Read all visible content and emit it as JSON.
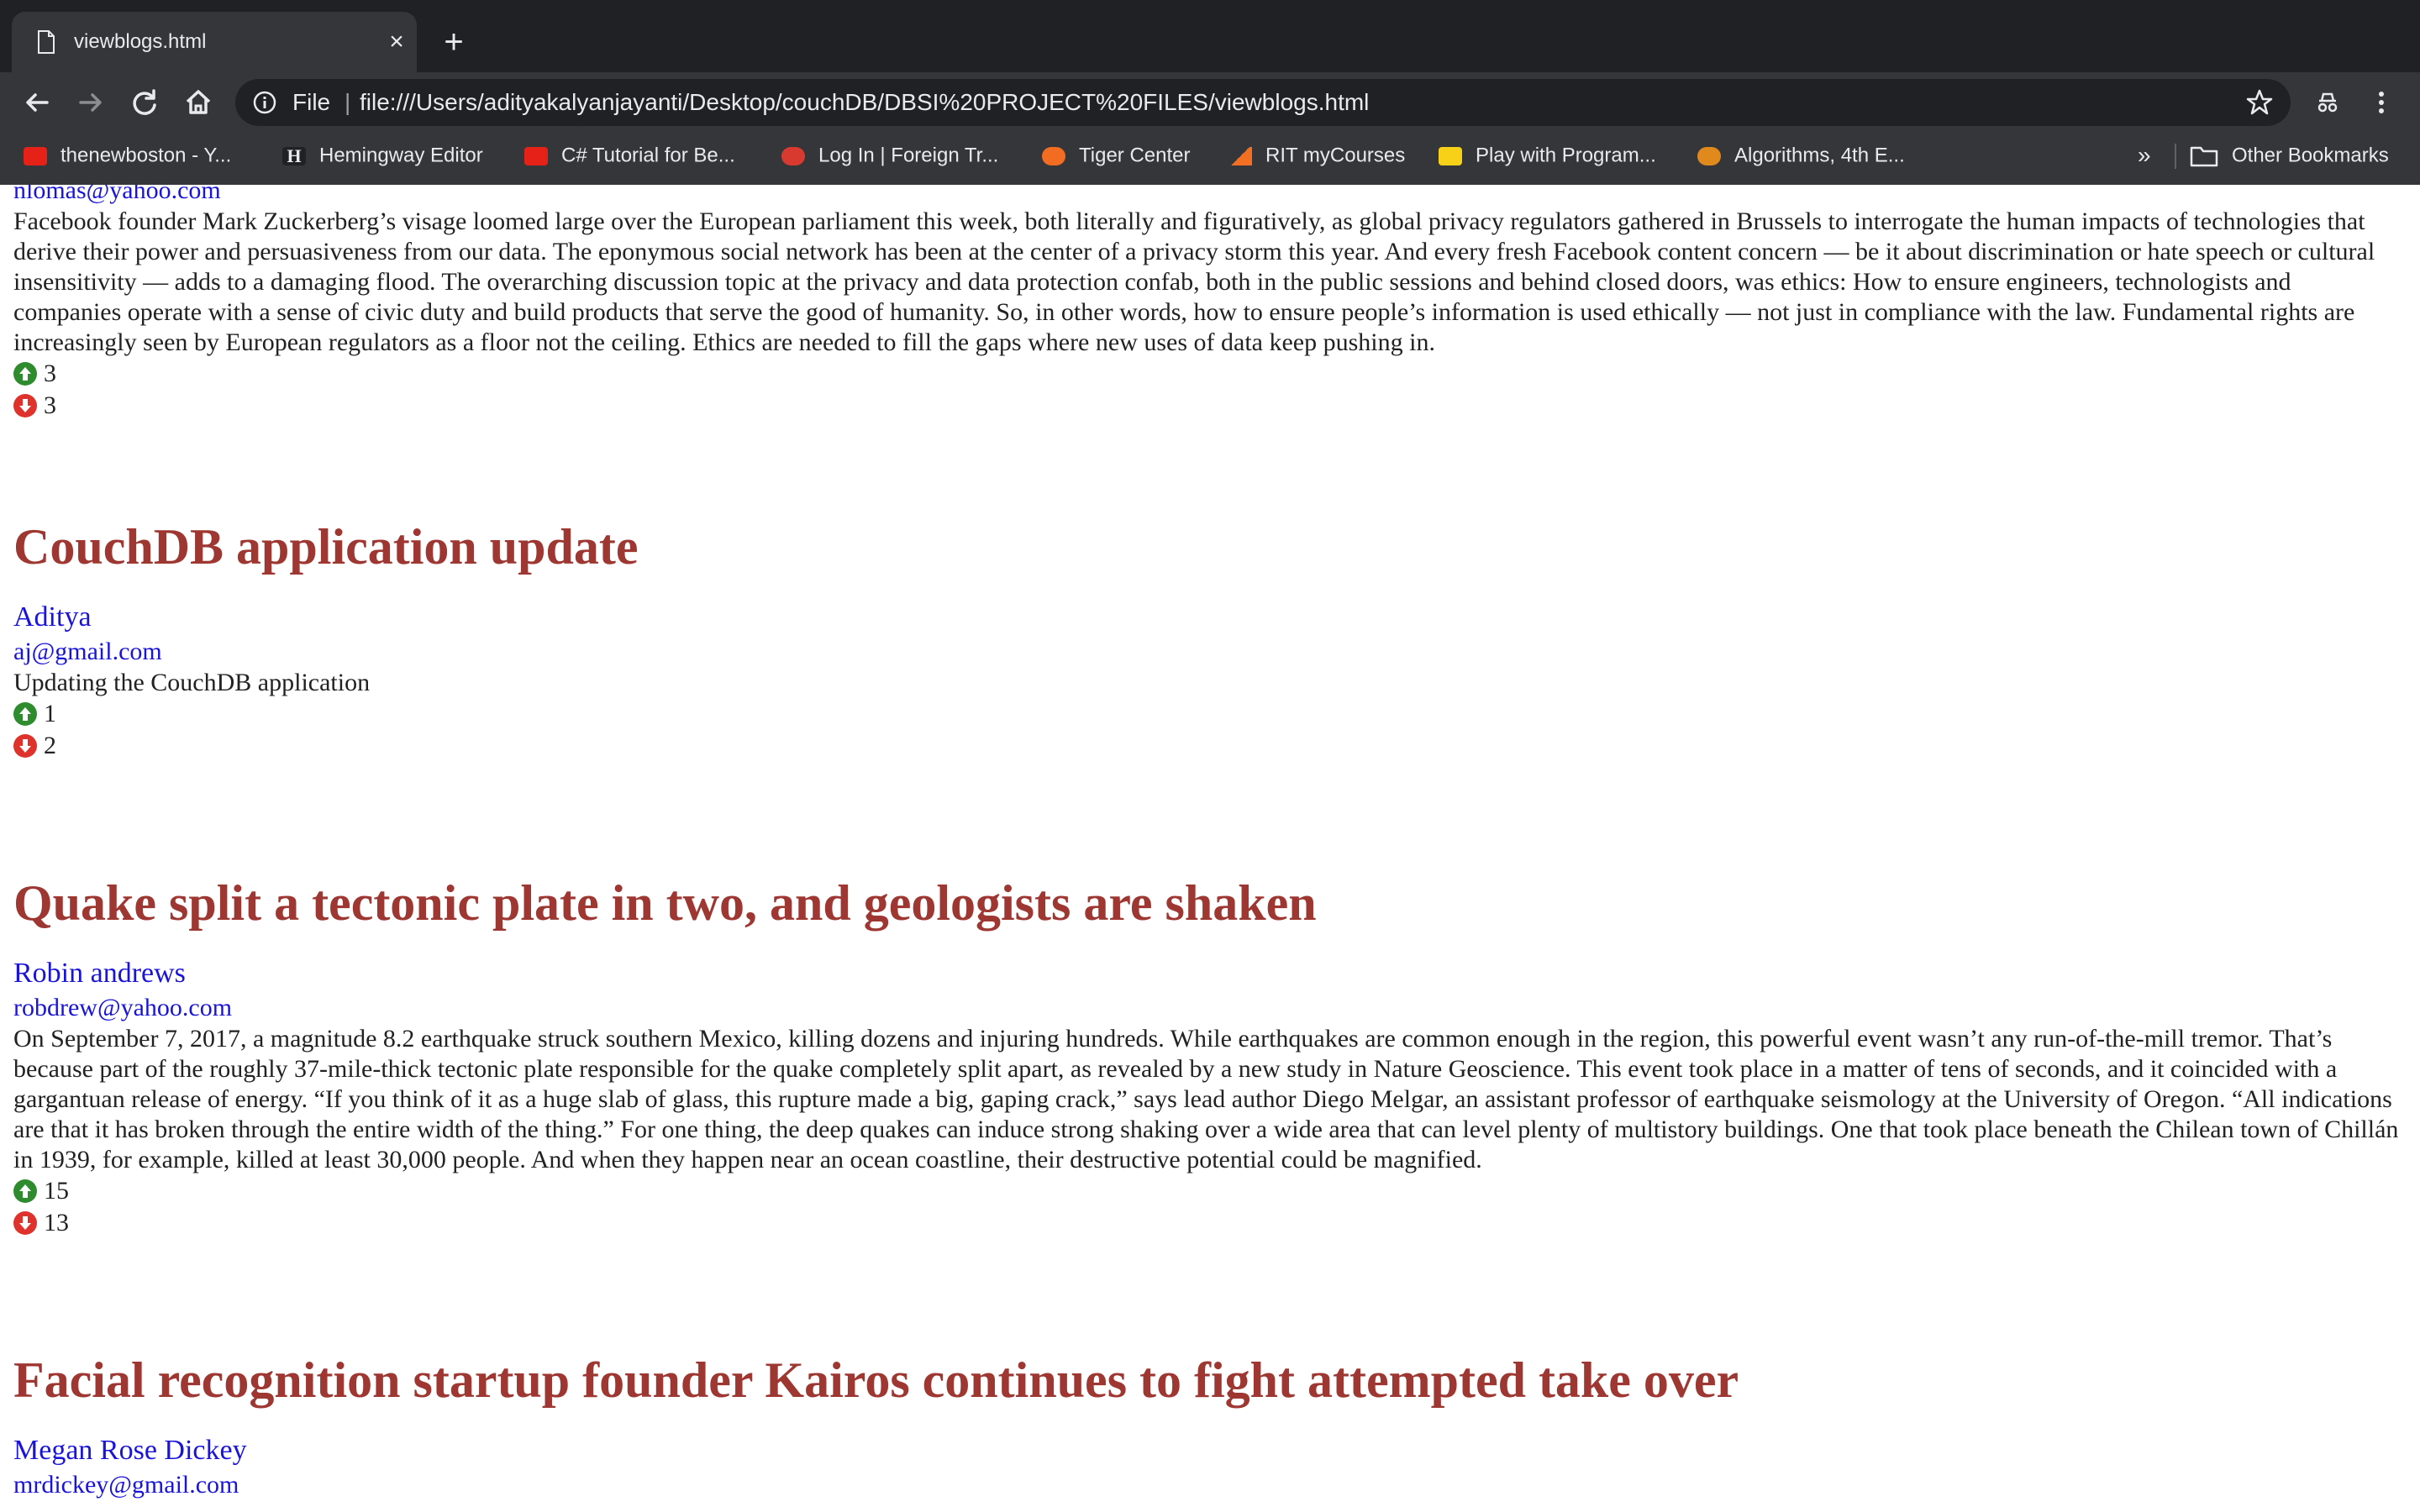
{
  "browser": {
    "tab_title": "viewblogs.html",
    "close_glyph": "×",
    "new_tab_glyph": "+",
    "url_scheme": "File",
    "url_separator": "|",
    "url": "file:///Users/adityakalyanjayanti/Desktop/couchDB/DBSI%20PROJECT%20FILES/viewblogs.html",
    "bookmarks": [
      {
        "label": "thenewboston - Y...",
        "icon": "youtube-icon",
        "color": "#e62117"
      },
      {
        "label": "Hemingway Editor",
        "icon": "hemingway-icon",
        "color": "#202124"
      },
      {
        "label": "C# Tutorial for Be...",
        "icon": "youtube-icon",
        "color": "#e62117"
      },
      {
        "label": "Log In | Foreign Tr...",
        "icon": "foreign-tr-icon",
        "color": "#d93a2f"
      },
      {
        "label": "Tiger Center",
        "icon": "tiger-icon",
        "color": "#f26c22"
      },
      {
        "label": "RIT myCourses",
        "icon": "mycourses-icon",
        "color": "#f36f21"
      },
      {
        "label": "Play with Program...",
        "icon": "play-program-icon",
        "color": "#f7d117"
      },
      {
        "label": "Algorithms, 4th E...",
        "icon": "algorithms-icon",
        "color": "#e08a1e"
      }
    ],
    "overflow_glyph": "»",
    "other_bookmarks": "Other Bookmarks"
  },
  "posts": [
    {
      "title": "",
      "author": "",
      "email": "nlomas@yahoo.com",
      "body": "Facebook founder Mark Zuckerberg’s visage loomed large over the European parliament this week, both literally and figuratively, as global privacy regulators gathered in Brussels to interrogate the human impacts of technologies that derive their power and persuasiveness from our data. The eponymous social network has been at the center of a privacy storm this year. And every fresh Facebook content concern — be it about discrimination or hate speech or cultural insensitivity — adds to a damaging flood. The overarching discussion topic at the privacy and data protection confab, both in the public sessions and behind closed doors, was ethics: How to ensure engineers, technologists and companies operate with a sense of civic duty and build products that serve the good of humanity. So, in other words, how to ensure people’s information is used ethically — not just in compliance with the law. Fundamental rights are increasingly seen by European regulators as a floor not the ceiling. Ethics are needed to fill the gaps where new uses of data keep pushing in.",
      "upvotes": "3",
      "downvotes": "3"
    },
    {
      "title": "CouchDB application update",
      "author": "Aditya",
      "email": "aj@gmail.com",
      "body": "Updating the CouchDB application",
      "upvotes": "1",
      "downvotes": "2"
    },
    {
      "title": "Quake split a tectonic plate in two, and geologists are shaken",
      "author": "Robin andrews",
      "email": "robdrew@yahoo.com",
      "body": "On September 7, 2017, a magnitude 8.2 earthquake struck southern Mexico, killing dozens and injuring hundreds. While earthquakes are common enough in the region, this powerful event wasn’t any run-of-the-mill tremor. That’s because part of the roughly 37-mile-thick tectonic plate responsible for the quake completely split apart, as revealed by a new study in Nature Geoscience. This event took place in a matter of tens of seconds, and it coincided with a gargantuan release of energy. “If you think of it as a huge slab of glass, this rupture made a big, gaping crack,” says lead author Diego Melgar, an assistant professor of earthquake seismology at the University of Oregon. “All indications are that it has broken through the entire width of the thing.” For one thing, the deep quakes can induce strong shaking over a wide area that can level plenty of multistory buildings. One that took place beneath the Chilean town of Chillán in 1939, for example, killed at least 30,000 people. And when they happen near an ocean coastline, their destructive potential could be magnified.",
      "upvotes": "15",
      "downvotes": "13"
    },
    {
      "title": "Facial recognition startup founder Kairos continues to fight attempted take over",
      "author": "Megan Rose Dickey",
      "email": "mrdickey@gmail.com"
    }
  ]
}
